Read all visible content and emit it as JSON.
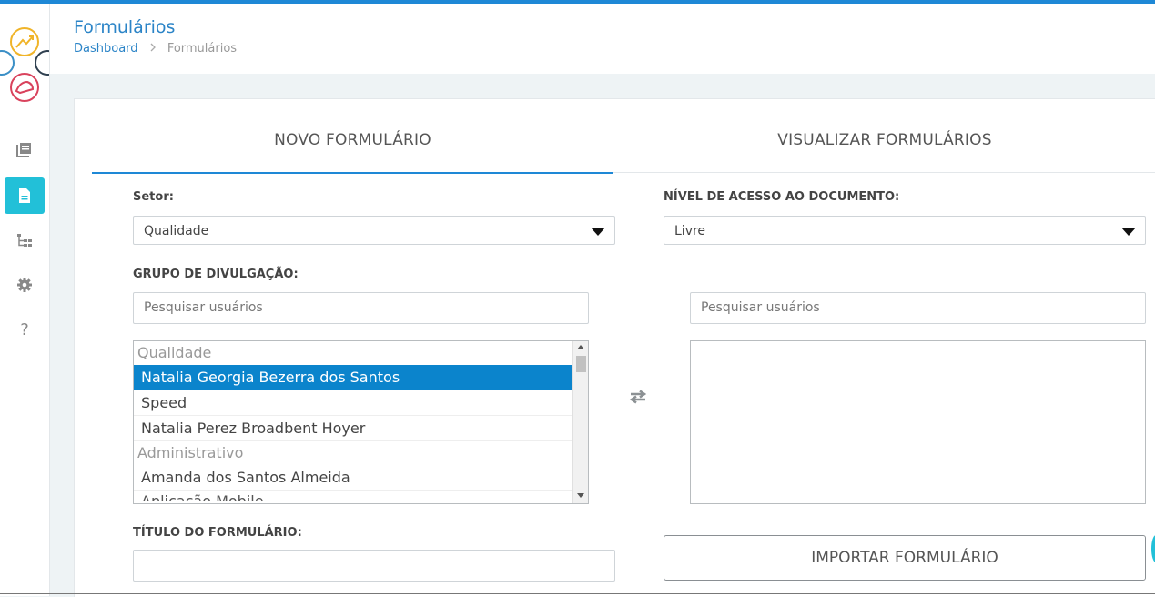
{
  "colors": {
    "accent": "#1e88d6",
    "active_nav": "#22c0d8",
    "selected_option": "#0b84cc"
  },
  "sidebar": {
    "logo": "colorful-circles-logo",
    "items": [
      {
        "icon": "library-icon",
        "active": false
      },
      {
        "icon": "document-icon",
        "active": true
      },
      {
        "icon": "hierarchy-icon",
        "active": false
      },
      {
        "icon": "gear-icon",
        "active": false
      },
      {
        "icon": "question-icon",
        "active": false,
        "glyph": "?"
      }
    ]
  },
  "header": {
    "title": "Formulários",
    "breadcrumb": {
      "home": "Dashboard",
      "current": "Formulários"
    }
  },
  "tabs": [
    {
      "label": "NOVO FORMULÁRIO",
      "active": true
    },
    {
      "label": "VISUALIZAR FORMULÁRIOS",
      "active": false
    }
  ],
  "form": {
    "setor": {
      "label": "Setor:",
      "value": "Qualidade"
    },
    "nivel_acesso": {
      "label": "NÍVEL DE ACESSO AO DOCUMENTO:",
      "value": "Livre"
    },
    "grupo": {
      "label": "GRUPO DE DIVULGAÇÃO:",
      "search_left_placeholder": "Pesquisar usuários",
      "search_right_placeholder": "Pesquisar usuários",
      "groups": [
        {
          "name": "Qualidade",
          "options": [
            "Natalia Georgia Bezerra dos Santos",
            "Speed",
            "Natalia Perez Broadbent Hoyer"
          ]
        },
        {
          "name": "Administrativo",
          "options": [
            "Amanda dos Santos Almeida",
            "Aplicação Mobile"
          ]
        }
      ],
      "selected_option": "Natalia Georgia Bezerra dos Santos",
      "swap_icon": "swap-arrows-icon"
    },
    "titulo": {
      "label": "TÍTULO DO FORMULÁRIO:",
      "value": ""
    },
    "import_button": "IMPORTAR FORMULÁRIO"
  }
}
